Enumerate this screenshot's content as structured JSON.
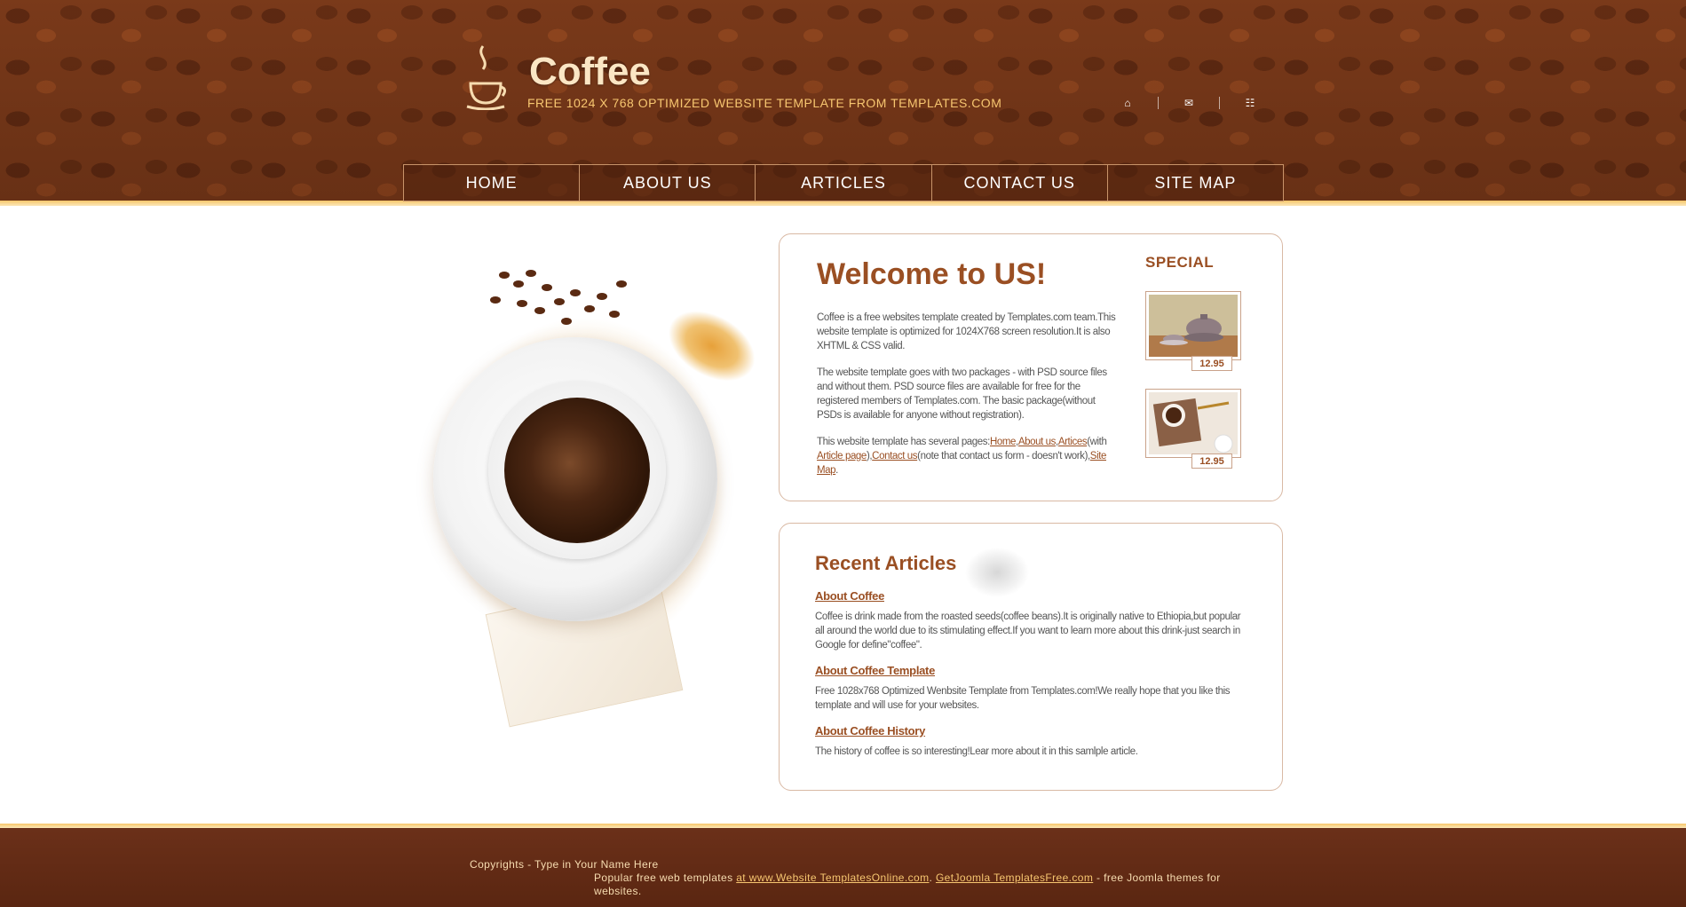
{
  "header": {
    "logo_title": "Coffee",
    "tagline": "FREE 1024 X 768 OPTIMIZED WEBSITE TEMPLATE FROM TEMPLATES.COM",
    "icons": [
      "home-icon",
      "mail-icon",
      "sitemap-icon"
    ]
  },
  "nav": {
    "items": [
      "HOME",
      "ABOUT US",
      "ARTICLES",
      "CONTACT US",
      "SITE MAP"
    ]
  },
  "welcome": {
    "title": "Welcome to US!",
    "p1": "Coffee is a free websites template created by Templates.com team.This website template is optimized for 1024X768 screen resolution.It is also XHTML & CSS valid.",
    "p2": "The website template goes with two packages - with PSD source files and without them. PSD source files are available for free for the registered members of Templates.com. The basic package(without PSDs is available for anyone without registration).",
    "p3_prefix": "This website template has several pages:",
    "links": {
      "home": "Home",
      "about": "About us",
      "articles": "Artices",
      "with_text": "(with ",
      "article_page": "Article page",
      "contact": "Contact us",
      "contact_note": "(note that contact us form - doesn't work),",
      "sitemap": "Site Map",
      "end": "."
    }
  },
  "special": {
    "title": "SPECIAL",
    "items": [
      {
        "price": "12.95"
      },
      {
        "price": "12.95"
      }
    ]
  },
  "recent": {
    "title": "Recent Articles",
    "articles": [
      {
        "title": "About Coffee",
        "body": "Coffee is drink made from the roasted seeds(coffee beans).It is originally native to Ethiopia,but popular all around the world due to its stimulating effect.If you want to learn more about this drink-just search in Google for define\"coffee\"."
      },
      {
        "title": "About Coffee Template",
        "body": "Free 1028x768 Optimized Wenbsite Template from Templates.com!We really hope that you like this template and will use for your websites."
      },
      {
        "title": "About Coffee History",
        "body": "The history of coffee is so interesting!Lear more about it in this samlple article."
      }
    ]
  },
  "footer": {
    "copyright": "Copyrights - Type in Your Name Here",
    "popular_prefix": "Popular free web templates ",
    "link1": "at www.Website TemplatesOnline.com",
    "sep": ". ",
    "link2": "GetJoomla TemplatesFree.com",
    "suffix": " - free Joomla themes for websites."
  },
  "colors": {
    "brand_brown": "#9a4f23",
    "header_bg": "#7a3a1a",
    "footer_bg": "#5a2611",
    "gold": "#f6c76a"
  }
}
